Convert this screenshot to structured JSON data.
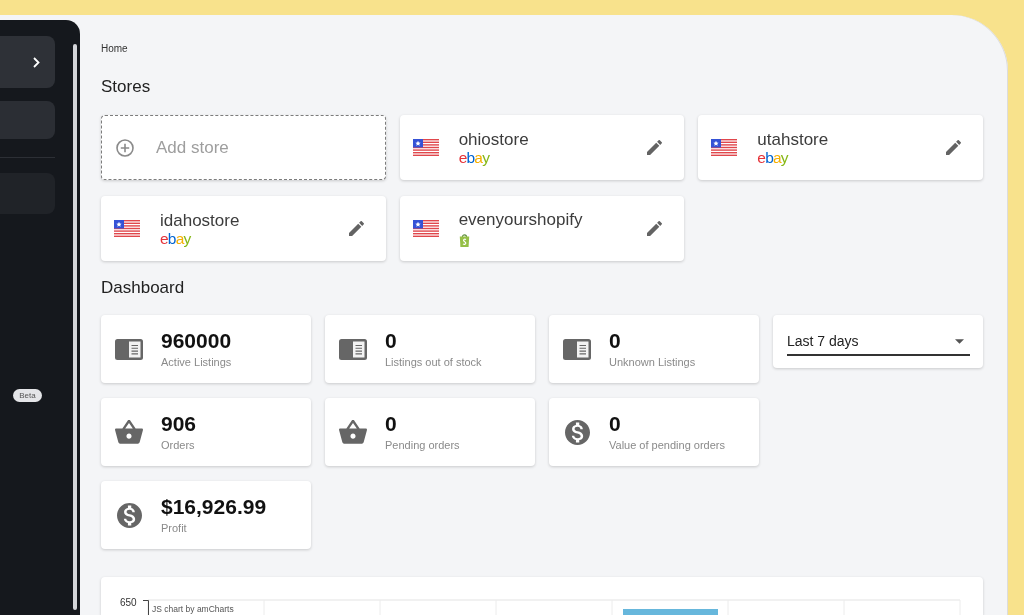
{
  "sidebar": {
    "badge": "Beta"
  },
  "breadcrumb": "Home",
  "stores": {
    "title": "Stores",
    "add_label": "Add store",
    "items": [
      {
        "name": "ohiostore",
        "kind": "ebay",
        "logo_text": "ebay"
      },
      {
        "name": "utahstore",
        "kind": "ebay",
        "logo_text": "ebay"
      },
      {
        "name": "idahostore",
        "kind": "ebay",
        "logo_text": "ebay"
      },
      {
        "name": "evenyourshopify",
        "kind": "shopify"
      }
    ]
  },
  "dashboard": {
    "title": "Dashboard",
    "period": {
      "value": "Last 7 days"
    },
    "groups": [
      {
        "stats": [
          {
            "kind": "listings",
            "value": "960000",
            "label": "Active Listings"
          },
          {
            "kind": "listings",
            "value": "0",
            "label": "Listings out of stock"
          },
          {
            "kind": "listings",
            "value": "0",
            "label": "Unknown Listings"
          }
        ]
      },
      {
        "stats": [
          {
            "kind": "orders",
            "value": "906",
            "label": "Orders"
          },
          {
            "kind": "orders",
            "value": "0",
            "label": "Pending orders"
          },
          {
            "kind": "money",
            "value": "0",
            "label": "Value of pending orders"
          }
        ]
      },
      {
        "stats": [
          {
            "kind": "money",
            "value": "$16,926.99",
            "label": "Profit"
          }
        ]
      }
    ]
  },
  "chart": {
    "y_tick": "650",
    "credit": "JS chart by amCharts"
  }
}
